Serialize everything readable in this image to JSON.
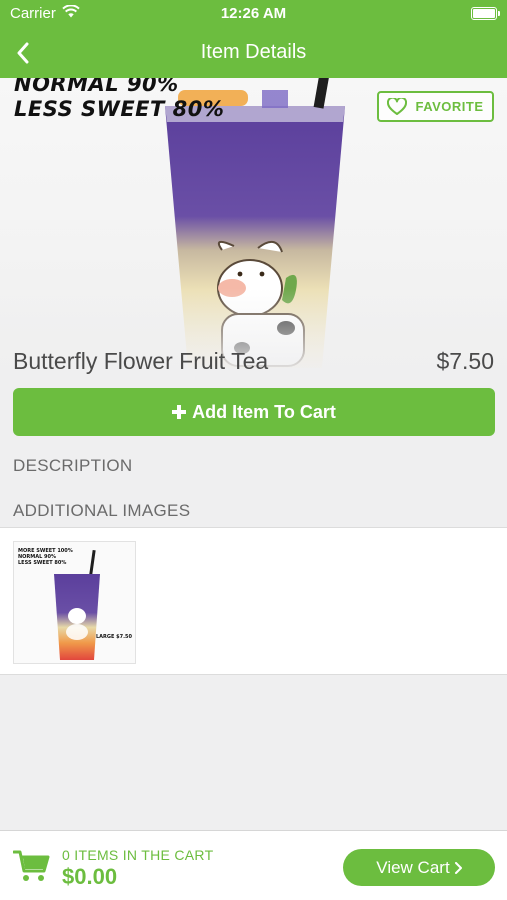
{
  "status_bar": {
    "carrier": "Carrier",
    "time": "12:26 AM"
  },
  "nav": {
    "title": "Item Details"
  },
  "hero": {
    "overlay_lines": [
      "NORMAL 90%",
      "LESS SWEET 80%"
    ],
    "favorite_label": "FAVORITE"
  },
  "item": {
    "name": "Butterfly Flower Fruit Tea",
    "price": "$7.50"
  },
  "add_to_cart_label": "Add Item To Cart",
  "description_header": "DESCRIPTION",
  "additional_images_header": "ADDITIONAL IMAGES",
  "thumbnail": {
    "overlay_lines": [
      "MORE SWEET 100%",
      "NORMAL 90%",
      "LESS SWEET 80%"
    ],
    "price_tag": "LARGE $7.50"
  },
  "cart": {
    "count_label": "0 ITEMS IN THE CART",
    "total": "$0.00",
    "view_cart_label": "View Cart"
  },
  "colors": {
    "brand_green": "#6cbd3f",
    "background": "#efeff0",
    "text_gray": "#4a4a4a"
  },
  "icons": {
    "wifi": "wifi-icon",
    "battery": "battery-icon",
    "back": "chevron-left-icon",
    "favorite": "heart-icon",
    "add": "plus-icon",
    "cart": "cart-icon",
    "view_cart": "chevron-right-icon"
  }
}
